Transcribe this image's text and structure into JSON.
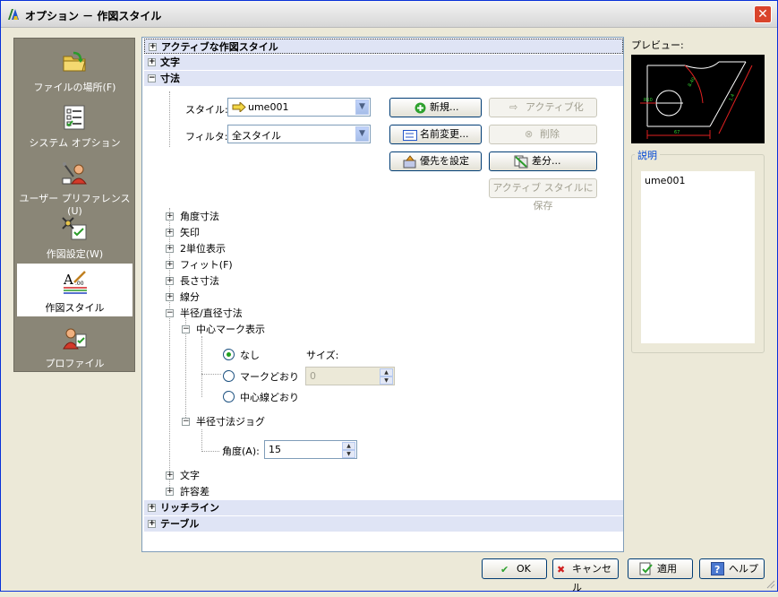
{
  "window": {
    "title": "オプション － 作図スタイル",
    "close_glyph": "✕"
  },
  "sidebar": {
    "items": [
      {
        "label": "ファイルの場所(F)",
        "icon": "folder-icon"
      },
      {
        "label": "システム オプション",
        "icon": "system-options-icon"
      },
      {
        "label": "ユーザー プリファレンス(U)",
        "icon": "user-preferences-icon"
      },
      {
        "label": "作図設定(W)",
        "icon": "drawing-settings-icon"
      },
      {
        "label": "作図スタイル",
        "icon": "drafting-style-icon",
        "active": true
      },
      {
        "label": "プロファイル",
        "icon": "profile-icon"
      }
    ]
  },
  "tree": {
    "sections": [
      {
        "label": "アクティブな作図スタイル",
        "expander": "+"
      },
      {
        "label": "文字",
        "expander": "+"
      },
      {
        "label": "寸法",
        "expander": "−"
      }
    ],
    "style_label": "スタイル:",
    "style_value": "ume001",
    "filter_label": "フィルタ:",
    "filter_value": "全スタイル",
    "buttons": {
      "new": "新規...",
      "activate": "アクティブ化",
      "rename": "名前変更...",
      "delete": "削除",
      "priority": "優先を設定",
      "diff": "差分...",
      "save_active": "アクティブ スタイルに保存"
    },
    "dim_children": [
      {
        "label": "角度寸法",
        "expander": "+"
      },
      {
        "label": "矢印",
        "expander": "+"
      },
      {
        "label": "2単位表示",
        "expander": "+"
      },
      {
        "label": "フィット(F)",
        "expander": "+"
      },
      {
        "label": "長さ寸法",
        "expander": "+"
      },
      {
        "label": "線分",
        "expander": "+"
      },
      {
        "label": "半径/直径寸法",
        "expander": "−"
      }
    ],
    "center_mark": {
      "label": "中心マーク表示",
      "none": "なし",
      "mark": "マークどおり",
      "centerline": "中心線どおり",
      "size_label": "サイズ:",
      "size_value": "0",
      "selected": "none"
    },
    "jog": {
      "label": "半径寸法ジョグ",
      "angle_label": "角度(A):",
      "angle_value": "15"
    },
    "dim_tail": [
      {
        "label": "文字",
        "expander": "+"
      },
      {
        "label": "許容差",
        "expander": "+"
      }
    ],
    "sections_after": [
      {
        "label": "リッチライン",
        "expander": "+"
      },
      {
        "label": "テーブル",
        "expander": "+"
      }
    ]
  },
  "preview": {
    "label": "プレビュー:",
    "dims": {
      "d1": "R10",
      "d2": "8.40",
      "d3": "1.4",
      "d4": "67"
    }
  },
  "description": {
    "legend": "説明",
    "text": "ume001"
  },
  "footer": {
    "ok": "OK",
    "cancel": "キャンセル",
    "apply": "適用",
    "help": "ヘルプ"
  },
  "colors": {
    "accent": "#0046d5",
    "section_bg": "#dfe4f5",
    "sidebar_bg": "#8a8677"
  }
}
